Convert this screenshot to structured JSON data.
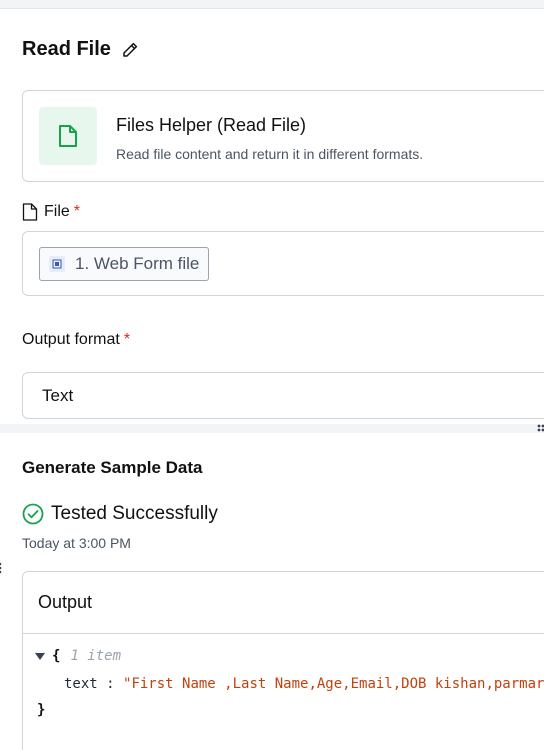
{
  "step": {
    "title": "Read File",
    "edit_icon": "pencil-icon"
  },
  "app": {
    "name": "Files Helper (Read File)",
    "description": "Read file content and return it in different formats.",
    "icon": "file-icon",
    "icon_color": "#16a34a"
  },
  "fields": {
    "file": {
      "label": "File",
      "required_mark": "*",
      "icon": "document-icon",
      "value_chip": "1. Web Form file"
    },
    "output_format": {
      "label": "Output format",
      "required_mark": "*",
      "value": "Text"
    }
  },
  "sample": {
    "section_title": "Generate Sample Data",
    "status": "Tested Successfully",
    "status_icon": "check-circle-icon",
    "status_color": "#16a34a",
    "timestamp": "Today at 3:00 PM"
  },
  "output": {
    "title": "Output",
    "open_brace": "{",
    "item_count": "1 item",
    "key": "text",
    "colon": " : ",
    "value": "\"First Name ,Last Name,Age,Email,DOB kishan,parmar,",
    "close_brace": "}"
  },
  "colors": {
    "required": "#dc2626",
    "string_value": "#c2410c"
  }
}
